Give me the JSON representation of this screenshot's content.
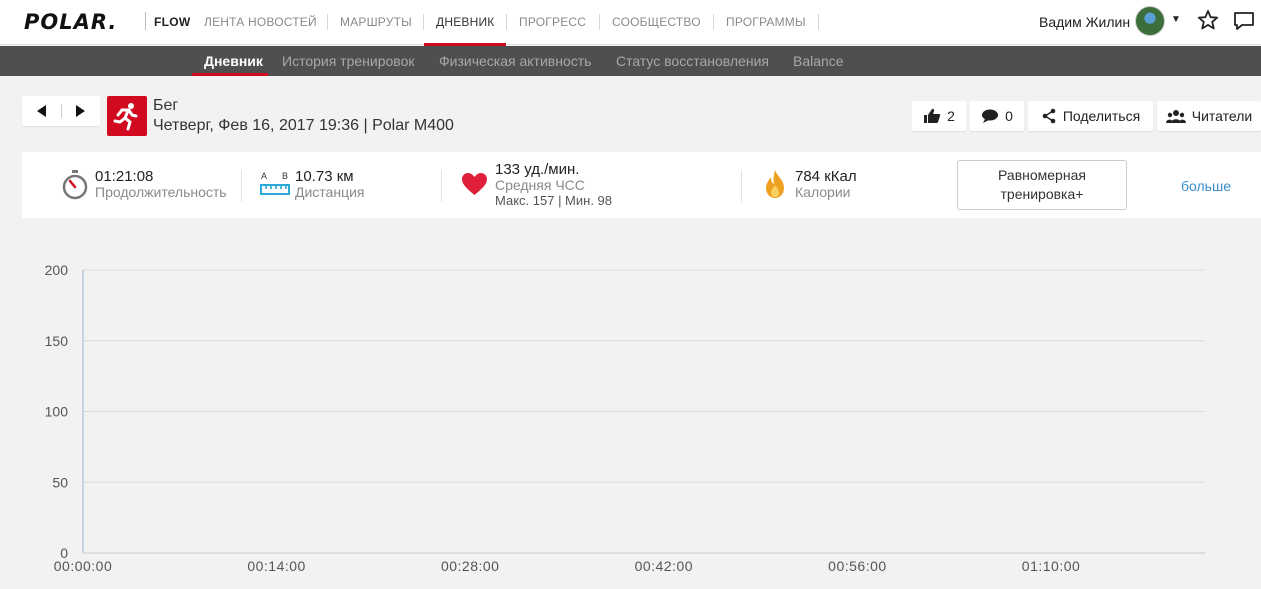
{
  "topnav": {
    "logo": "POLAR.",
    "brand_app": "FLOW",
    "items": [
      {
        "label": "ЛЕНТА НОВОСТЕЙ",
        "active": false
      },
      {
        "label": "МАРШРУТЫ",
        "active": false
      },
      {
        "label": "ДНЕВНИК",
        "active": true
      },
      {
        "label": "ПРОГРЕСС",
        "active": false
      },
      {
        "label": "СООБЩЕСТВО",
        "active": false
      },
      {
        "label": "ПРОГРАММЫ",
        "active": false
      }
    ],
    "user_name": "Вадим Жилин"
  },
  "subnav": {
    "items": [
      {
        "label": "Дневник",
        "active": true
      },
      {
        "label": "История тренировок",
        "active": false
      },
      {
        "label": "Физическая активность",
        "active": false
      },
      {
        "label": "Статус восстановления",
        "active": false
      },
      {
        "label": "Balance",
        "active": false
      }
    ]
  },
  "session": {
    "sport": "Бег",
    "datetime_device": "Четверг, Фев 16, 2017 19:36 | Polar M400",
    "likes": "2",
    "comments": "0",
    "share_label": "Поделиться",
    "readers_label": "Читатели"
  },
  "stats": {
    "duration": {
      "value": "01:21:08",
      "label": "Продолжительность"
    },
    "distance": {
      "value": "10.73 км",
      "label": "Дистанция",
      "icon_a": "A",
      "icon_b": "B"
    },
    "heart_rate": {
      "value": "133 уд./мин.",
      "label": "Средняя ЧСС",
      "max_min": "Макс. 157  |  Мин. 98"
    },
    "calories": {
      "value": "784 кКал",
      "label": "Калории"
    },
    "training_type": "Равномерная тренировка+",
    "more_label": "больше"
  },
  "colors": {
    "accent": "#d10a20",
    "subnav_bg": "#4f4f4f",
    "link": "#3a8fc9",
    "heart": "#e0203a",
    "flame": "#f0a020",
    "distance_icon": "#2aa8d8"
  },
  "chart_data": {
    "type": "line",
    "title": "",
    "xlabel": "",
    "ylabel": "",
    "x_ticks": [
      "00:00:00",
      "00:14:00",
      "00:28:00",
      "00:42:00",
      "00:56:00",
      "01:10:00"
    ],
    "y_ticks": [
      0,
      50,
      100,
      150,
      200
    ],
    "ylim": [
      0,
      200
    ],
    "xlim_seconds": [
      0,
      4868
    ],
    "series": [],
    "grid": true
  }
}
